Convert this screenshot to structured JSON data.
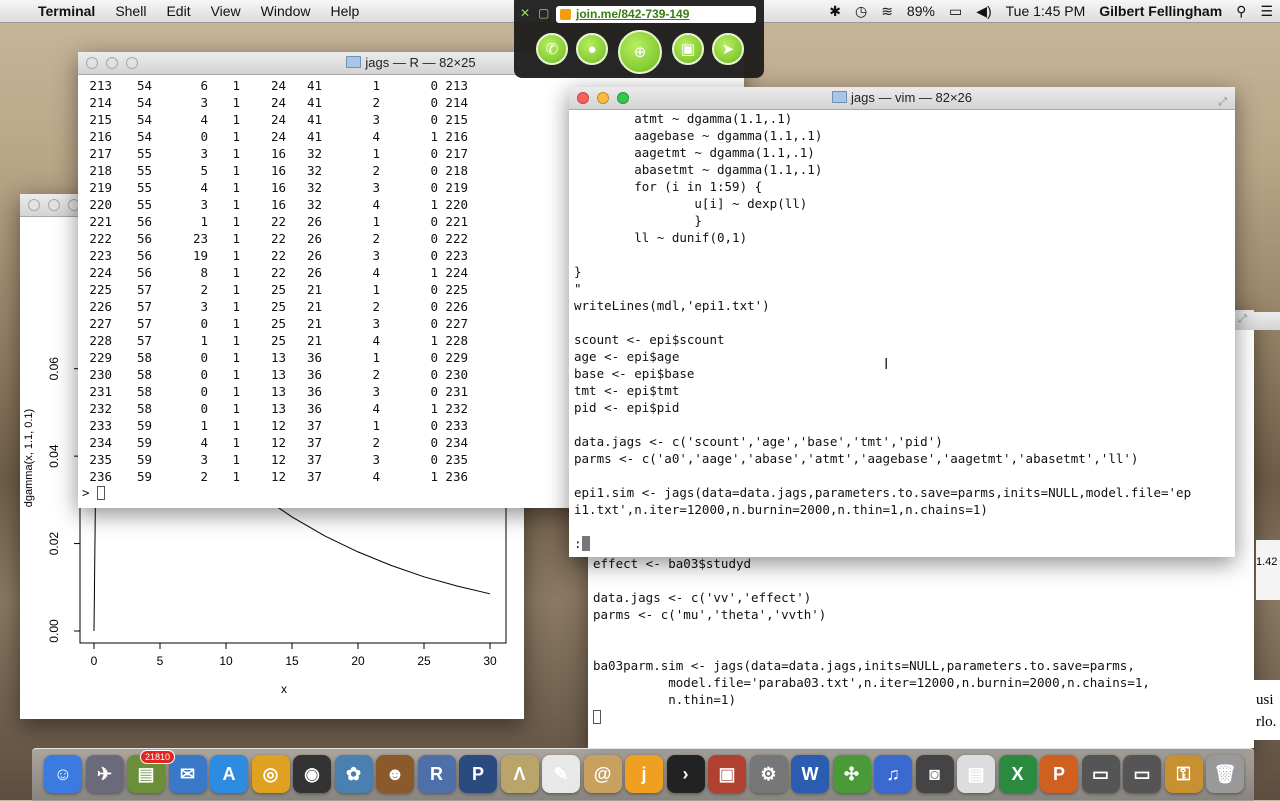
{
  "menubar": {
    "apple": "",
    "app": "Terminal",
    "items": [
      "Shell",
      "Edit",
      "View",
      "Window",
      "Help"
    ],
    "battery": "89%",
    "clock": "Tue 1:45 PM",
    "user": "Gilbert Fellingham"
  },
  "joinme": {
    "url": "join.me/842-739-149"
  },
  "r_window": {
    "title": "jags — R — 82×25",
    "rows": [
      [
        "213",
        "54",
        "6",
        "1",
        "24",
        "41",
        "1",
        "0",
        "213"
      ],
      [
        "214",
        "54",
        "3",
        "1",
        "24",
        "41",
        "2",
        "0",
        "214"
      ],
      [
        "215",
        "54",
        "4",
        "1",
        "24",
        "41",
        "3",
        "0",
        "215"
      ],
      [
        "216",
        "54",
        "0",
        "1",
        "24",
        "41",
        "4",
        "1",
        "216"
      ],
      [
        "217",
        "55",
        "3",
        "1",
        "16",
        "32",
        "1",
        "0",
        "217"
      ],
      [
        "218",
        "55",
        "5",
        "1",
        "16",
        "32",
        "2",
        "0",
        "218"
      ],
      [
        "219",
        "55",
        "4",
        "1",
        "16",
        "32",
        "3",
        "0",
        "219"
      ],
      [
        "220",
        "55",
        "3",
        "1",
        "16",
        "32",
        "4",
        "1",
        "220"
      ],
      [
        "221",
        "56",
        "1",
        "1",
        "22",
        "26",
        "1",
        "0",
        "221"
      ],
      [
        "222",
        "56",
        "23",
        "1",
        "22",
        "26",
        "2",
        "0",
        "222"
      ],
      [
        "223",
        "56",
        "19",
        "1",
        "22",
        "26",
        "3",
        "0",
        "223"
      ],
      [
        "224",
        "56",
        "8",
        "1",
        "22",
        "26",
        "4",
        "1",
        "224"
      ],
      [
        "225",
        "57",
        "2",
        "1",
        "25",
        "21",
        "1",
        "0",
        "225"
      ],
      [
        "226",
        "57",
        "3",
        "1",
        "25",
        "21",
        "2",
        "0",
        "226"
      ],
      [
        "227",
        "57",
        "0",
        "1",
        "25",
        "21",
        "3",
        "0",
        "227"
      ],
      [
        "228",
        "57",
        "1",
        "1",
        "25",
        "21",
        "4",
        "1",
        "228"
      ],
      [
        "229",
        "58",
        "0",
        "1",
        "13",
        "36",
        "1",
        "0",
        "229"
      ],
      [
        "230",
        "58",
        "0",
        "1",
        "13",
        "36",
        "2",
        "0",
        "230"
      ],
      [
        "231",
        "58",
        "0",
        "1",
        "13",
        "36",
        "3",
        "0",
        "231"
      ],
      [
        "232",
        "58",
        "0",
        "1",
        "13",
        "36",
        "4",
        "1",
        "232"
      ],
      [
        "233",
        "59",
        "1",
        "1",
        "12",
        "37",
        "1",
        "0",
        "233"
      ],
      [
        "234",
        "59",
        "4",
        "1",
        "12",
        "37",
        "2",
        "0",
        "234"
      ],
      [
        "235",
        "59",
        "3",
        "1",
        "12",
        "37",
        "3",
        "0",
        "235"
      ],
      [
        "236",
        "59",
        "2",
        "1",
        "12",
        "37",
        "4",
        "1",
        "236"
      ]
    ],
    "prompt": ">"
  },
  "vim_window": {
    "title": "jags — vim — 82×26",
    "lines": [
      "        atmt ~ dgamma(1.1,.1)",
      "        aagebase ~ dgamma(1.1,.1)",
      "        aagetmt ~ dgamma(1.1,.1)",
      "        abasetmt ~ dgamma(1.1,.1)",
      "        for (i in 1:59) {",
      "                u[i] ~ dexp(ll)",
      "                }",
      "        ll ~ dunif(0,1)",
      "",
      "}",
      "\"",
      "writeLines(mdl,'epi1.txt')",
      "",
      "scount <- epi$scount",
      "age <- epi$age",
      "base <- epi$base",
      "tmt <- epi$tmt",
      "pid <- epi$pid",
      "",
      "data.jags <- c('scount','age','base','tmt','pid')",
      "parms <- c('a0','aage','abase','atmt','aagebase','aagetmt','abasetmt','ll')",
      "",
      "epi1.sim <- jags(data=data.jags,parameters.to.save=parms,inits=NULL,model.file='ep",
      "i1.txt',n.iter=12000,n.burnin=2000,n.thin=1,n.chains=1)",
      "",
      ":"
    ]
  },
  "back_window": {
    "lines": [
      "effect <- ba03$studyd",
      "",
      "data.jags <- c('vv','effect')",
      "parms <- c('mu','theta','vvth')",
      "",
      "",
      "ba03parm.sim <- jags(data=data.jags,inits=NULL,parameters.to.save=parms,",
      "          model.file='paraba03.txt',n.iter=12000,n.burnin=2000,n.chains=1,",
      "          n.thin=1)"
    ],
    "edge_text_1": "1.42",
    "edge_text_2": "usi",
    "edge_text_3": "rlo."
  },
  "chart_data": {
    "type": "line",
    "title": "",
    "xlabel": "x",
    "ylabel": "dgamma(x, 1.1, 0.1)",
    "xlim": [
      0,
      30
    ],
    "ylim": [
      0,
      0.07
    ],
    "xticks": [
      "0",
      "5",
      "10",
      "15",
      "20",
      "25",
      "30"
    ],
    "yticks": [
      "0.00",
      "0.02",
      "0.04",
      "0.06"
    ],
    "series": [
      {
        "x": [
          0,
          0.2,
          0.5,
          1,
          2,
          3,
          5,
          7.5,
          10,
          12.5,
          15,
          17.5,
          20,
          22.5,
          25,
          27.5,
          30
        ],
        "y": [
          0,
          0.0552,
          0.0605,
          0.0626,
          0.0617,
          0.0584,
          0.0519,
          0.0441,
          0.0372,
          0.0312,
          0.0261,
          0.0217,
          0.0181,
          0.015,
          0.0124,
          0.0103,
          0.0085
        ]
      }
    ],
    "grid": false
  },
  "dock": {
    "items": [
      "Finder",
      "Launchpad",
      "Preview",
      "Mail",
      "App Store",
      "Chrome",
      "Dashboard",
      "iPhoto",
      "Fetch",
      "R",
      "Pandora",
      "LaTeX",
      "TextEdit",
      "Contacts",
      "join.me",
      "Terminal",
      "Parallels",
      "System Preferences",
      "Microsoft Word",
      "Growl",
      "iTunes",
      "Screen Capture",
      "Preview Doc",
      "Excel",
      "PowerPoint",
      "Window 1",
      "Window 2",
      "Keychain",
      "Trash"
    ],
    "mail_badge": "21810"
  }
}
